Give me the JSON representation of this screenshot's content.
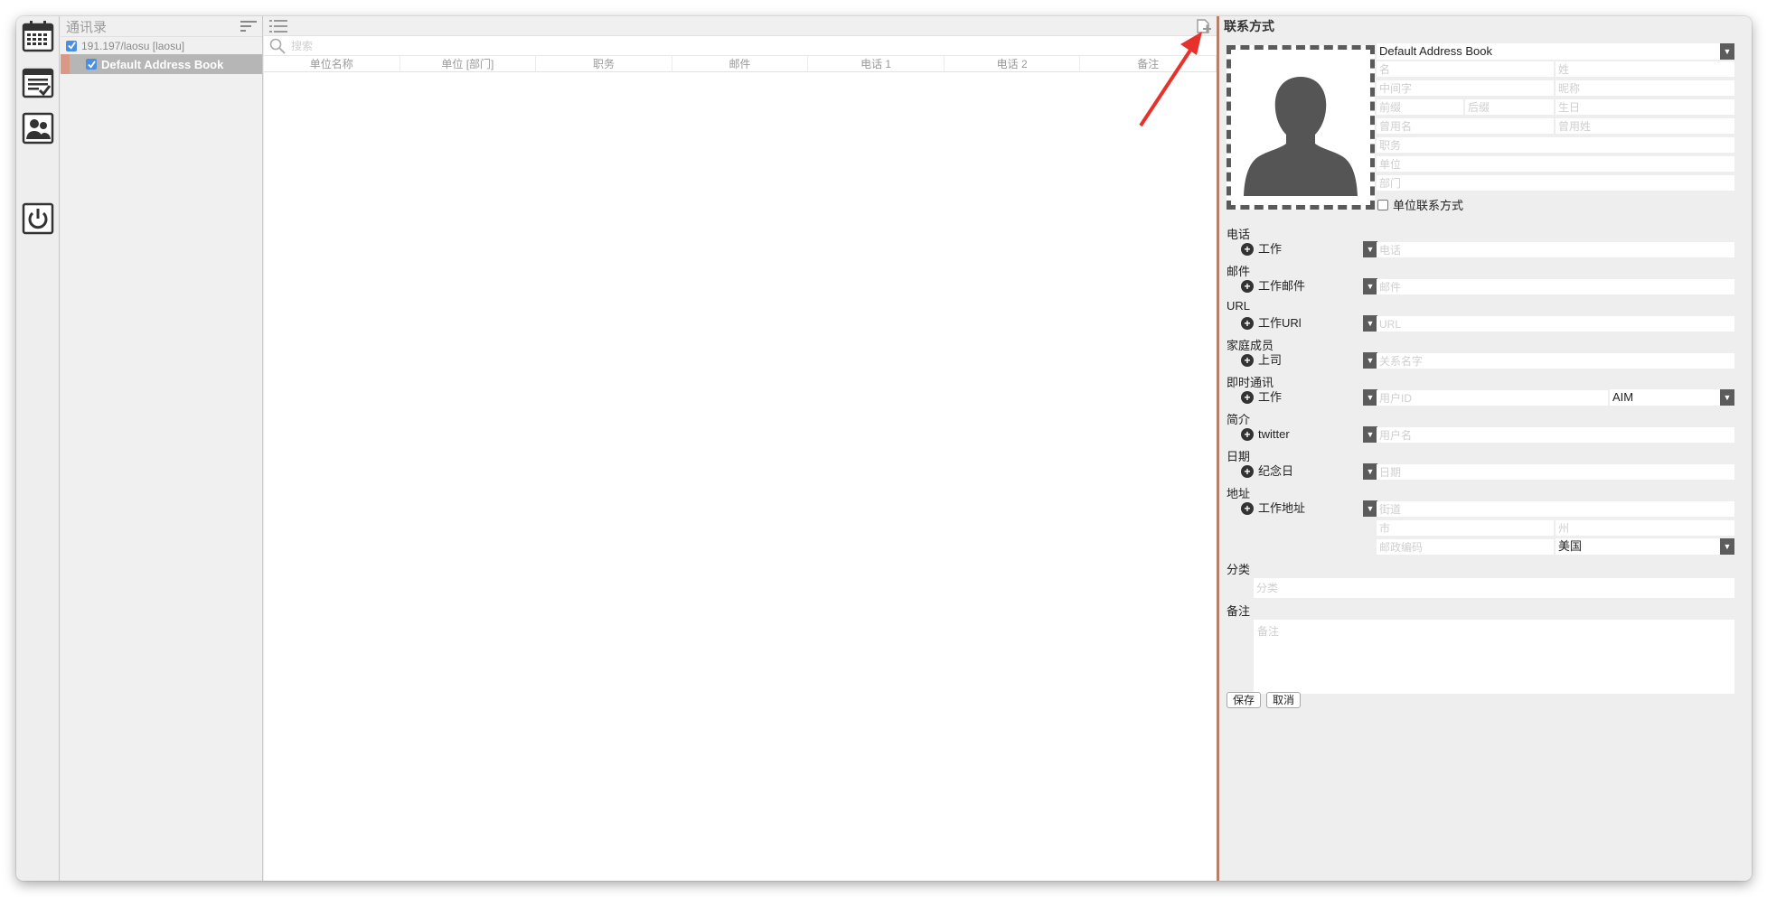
{
  "books_panel": {
    "title": "通讯录",
    "account_label": "191.197/laosu [laosu]",
    "book_label": "Default Address Book"
  },
  "list_panel": {
    "search_placeholder": "搜索",
    "columns": [
      "单位名称",
      "单位 [部门]",
      "职务",
      "邮件",
      "电话 1",
      "电话 2",
      "备注"
    ]
  },
  "form": {
    "title": "联系方式",
    "address_book": "Default Address Book",
    "placeholders": {
      "first_name": "名",
      "last_name": "姓",
      "middle_name": "中间字",
      "nickname": "昵称",
      "prefix": "前缀",
      "suffix": "后缀",
      "birthday": "生日",
      "former_first": "曾用名",
      "former_last": "曾用姓",
      "job_title": "职务",
      "company": "单位",
      "department": "部门",
      "phone": "电话",
      "email": "邮件",
      "url": "URL",
      "relation": "关系名字",
      "im_user": "用户ID",
      "profile_user": "用户名",
      "date": "日期",
      "street": "街道",
      "city": "市",
      "state": "州",
      "zip": "邮政编码",
      "category": "分类",
      "notes": "备注"
    },
    "company_contact_label": "单位联系方式",
    "sections": {
      "phone": "电话",
      "email": "邮件",
      "url": "URL",
      "family": "家庭成员",
      "im": "即时通讯",
      "profile": "简介",
      "date": "日期",
      "address": "地址",
      "category": "分类",
      "notes": "备注"
    },
    "types": {
      "phone": "工作",
      "email": "工作邮件",
      "url": "工作URl",
      "family": "上司",
      "im": "工作",
      "im_service": "AIM",
      "profile": "twitter",
      "date": "纪念日",
      "address": "工作地址",
      "country": "美国"
    },
    "buttons": {
      "save": "保存",
      "cancel": "取消"
    }
  },
  "colors": {
    "accent_red": "#e8312a",
    "selected_row": "#b6b6b6",
    "checkbox_blue": "#4a90e2",
    "divider": "#b87f6a"
  }
}
